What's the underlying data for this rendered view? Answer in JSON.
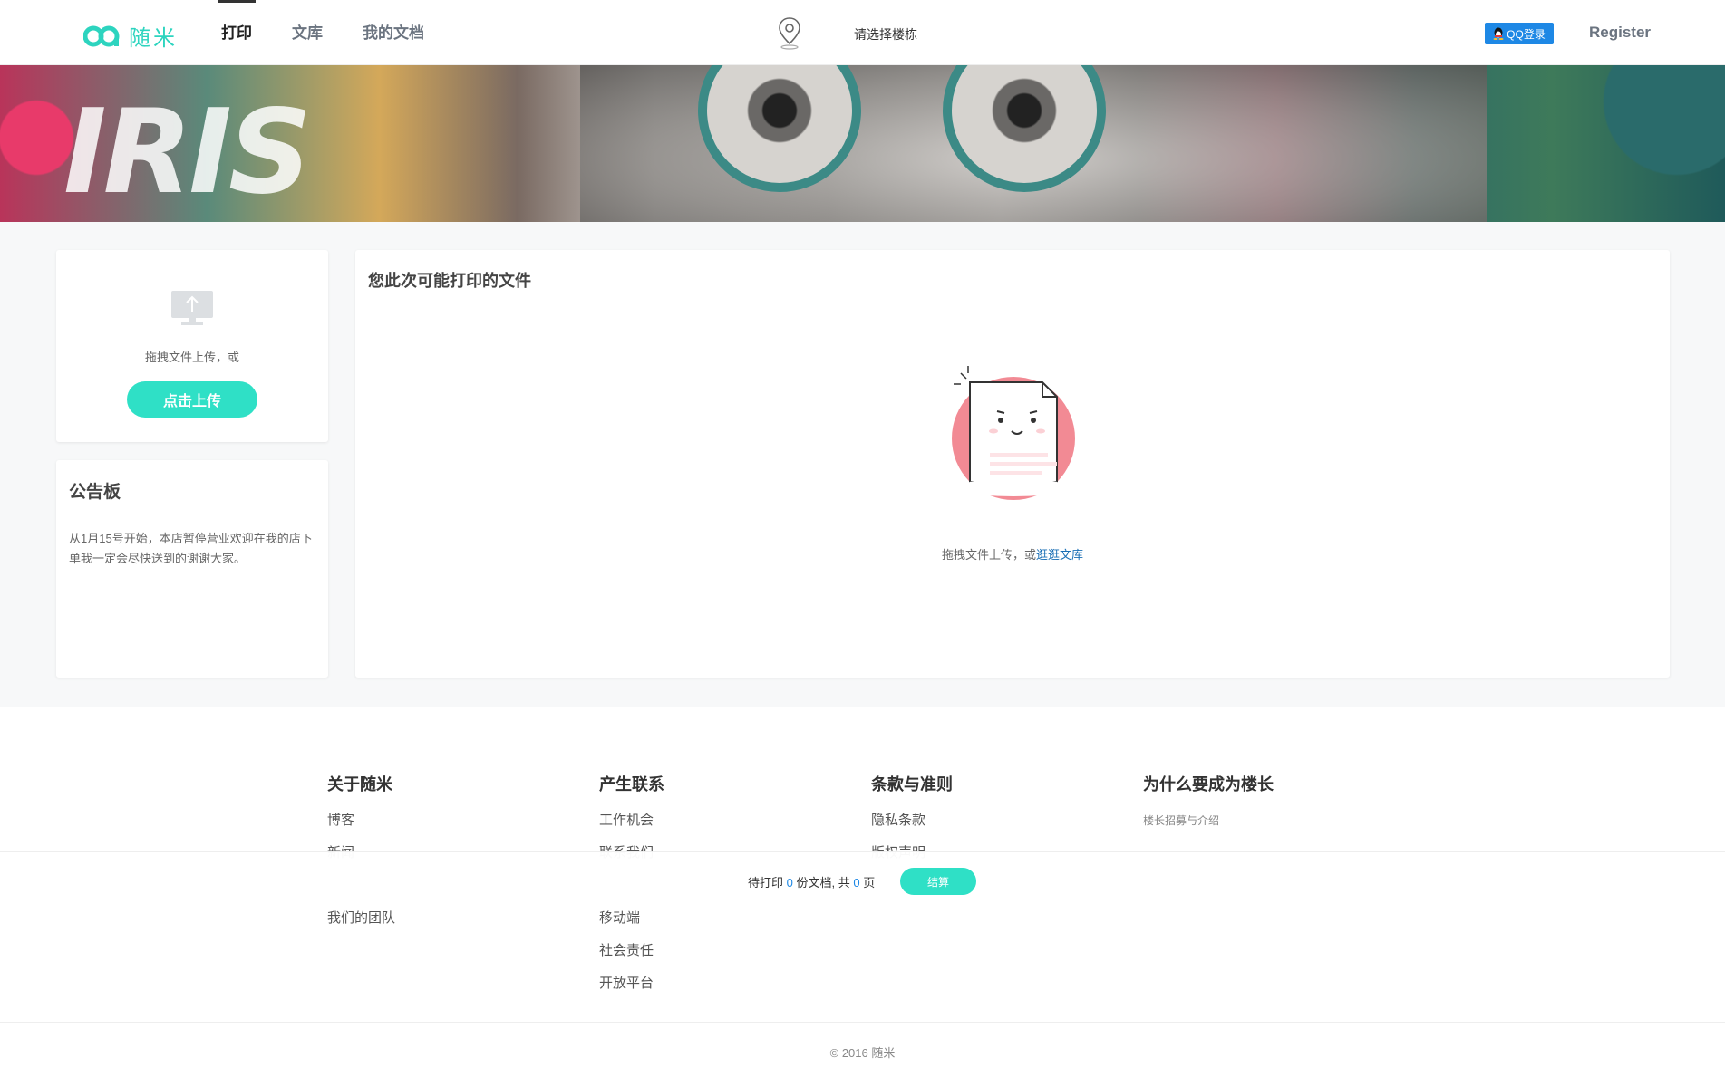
{
  "header": {
    "logo_text": "随米",
    "nav": [
      {
        "label": "打印",
        "active": true
      },
      {
        "label": "文库",
        "active": false
      },
      {
        "label": "我的文档",
        "active": false
      }
    ],
    "location_placeholder": "请选择楼栋",
    "qq_login_label": "QQ登录",
    "register_label": "Register"
  },
  "banner": {
    "text": "IRIS"
  },
  "upload": {
    "hint": "拖拽文件上传，或",
    "button_label": "点击上传"
  },
  "board": {
    "title": "公告板",
    "body": "从1月15号开始，本店暂停营业欢迎在我的店下单我一定会尽快送到的谢谢大家。"
  },
  "files": {
    "title": "您此次可能打印的文件",
    "empty_hint_prefix": "拖拽文件上传，或",
    "empty_hint_link": "逛逛文库"
  },
  "footer": {
    "columns": [
      {
        "title": "关于随米",
        "links": [
          "博客",
          "新闻",
          "",
          "我们的团队"
        ]
      },
      {
        "title": "产生联系",
        "links": [
          "工作机会",
          "联系我们",
          "",
          "移动端",
          "社会责任",
          "开放平台"
        ]
      },
      {
        "title": "条款与准则",
        "links": [
          "隐私条款",
          "版权声明"
        ]
      },
      {
        "title": "为什么要成为楼长",
        "links": [
          "楼长招募与介绍"
        ]
      }
    ],
    "copyright": "© 2016 随米"
  },
  "print_bar": {
    "prefix": "待打印",
    "doc_count": "0",
    "mid": "份文档, 共",
    "page_count": "0",
    "suffix": "页",
    "checkout_label": "结算"
  },
  "colors": {
    "accent": "#2fe0c6",
    "link": "#1a6fb5",
    "qq": "#1e88e5"
  }
}
